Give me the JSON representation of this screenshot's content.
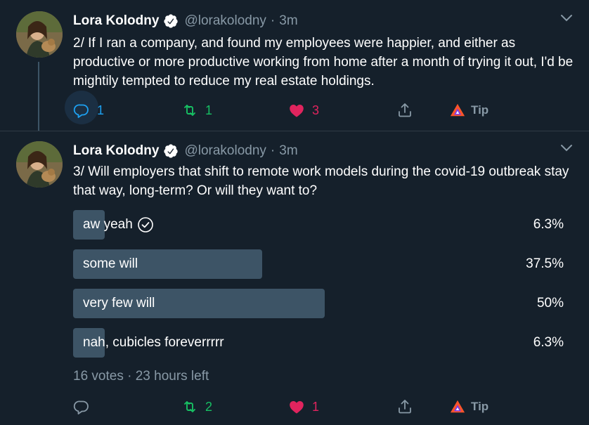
{
  "tweets": [
    {
      "author_name": "Lora Kolodny",
      "handle": "@lorakolodny",
      "separator": "·",
      "time": "3m",
      "text": "2/ If I ran a company, and found my employees were happier, and either as productive or more productive working from home after a month of trying it out, I'd be mightily tempted to reduce my real estate holdings.",
      "reply_count": "1",
      "retweet_count": "1",
      "like_count": "3",
      "tip_label": "Tip"
    },
    {
      "author_name": "Lora Kolodny",
      "handle": "@lorakolodny",
      "separator": "·",
      "time": "3m",
      "text": "3/ Will employers that shift to remote work models during the covid-19 outbreak stay that way, long-term? Or will they want to?",
      "reply_count": "",
      "retweet_count": "2",
      "like_count": "1",
      "tip_label": "Tip",
      "poll": {
        "options": [
          {
            "label": "aw yeah",
            "percent_text": "6.3%",
            "fraction": 0.063,
            "selected": true
          },
          {
            "label": "some will",
            "percent_text": "37.5%",
            "fraction": 0.375,
            "selected": false
          },
          {
            "label": "very few will",
            "percent_text": "50%",
            "fraction": 0.5,
            "selected": false
          },
          {
            "label": "nah, cubicles foreverrrrr",
            "percent_text": "6.3%",
            "fraction": 0.063,
            "selected": false
          }
        ],
        "meta": "16 votes · 23 hours left"
      }
    }
  ],
  "colors": {
    "background": "#15202b",
    "reply": "#1da1f2",
    "retweet": "#17bf63",
    "like": "#e0245e",
    "muted": "#8899a6",
    "poll_bar": "#3d5466",
    "tip_brand": "#fb542b"
  }
}
